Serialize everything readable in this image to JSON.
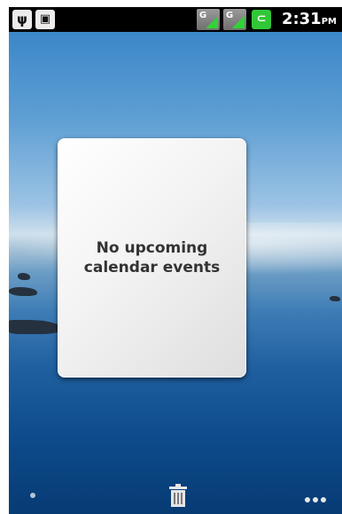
{
  "status_bar": {
    "icons": [
      "usb-icon",
      "debug-icon",
      "signal-icon",
      "signal-icon",
      "battery-icon"
    ],
    "signal_label": "G",
    "time": "2:31",
    "ampm": "PM"
  },
  "widget": {
    "message": "No upcoming calendar events"
  },
  "dock": {
    "icons": [
      "dot-icon",
      "trash-icon",
      "more-icon"
    ]
  }
}
